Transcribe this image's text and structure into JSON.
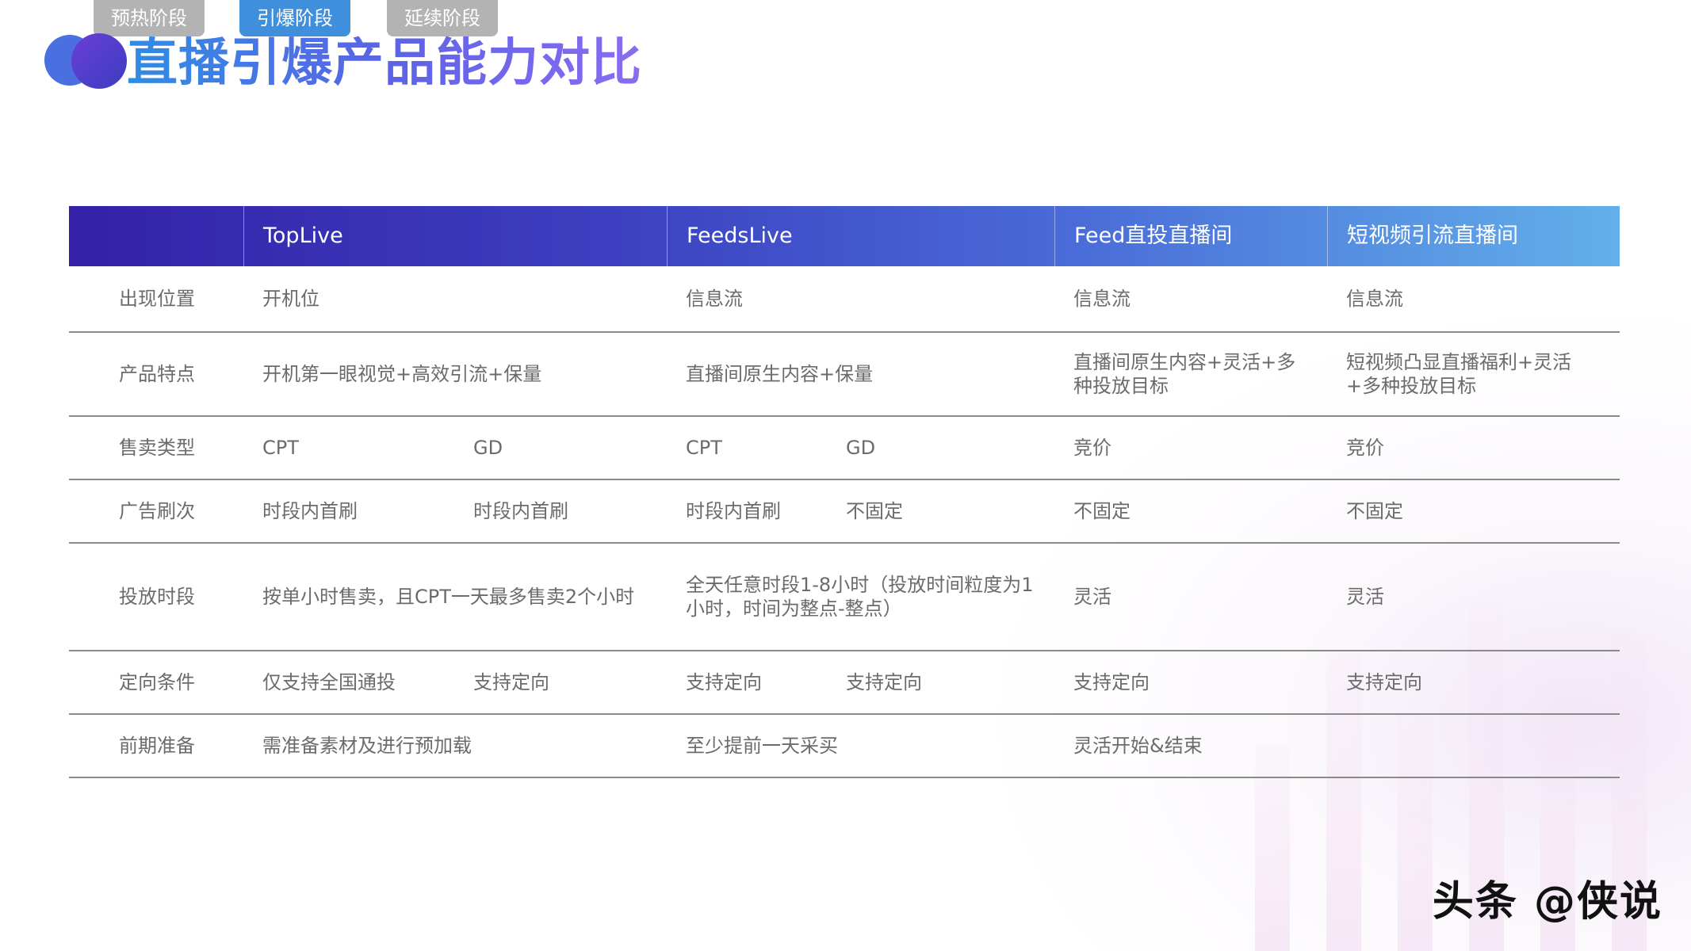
{
  "stages": [
    "预热阶段",
    "引爆阶段",
    "延续阶段"
  ],
  "title": "直播引爆产品能力对比",
  "table": {
    "headers": [
      "",
      "TopLive",
      "FeedsLive",
      "Feed直投直播间",
      "短视频引流直播间"
    ],
    "rows": [
      {
        "label": "出现位置",
        "toplive_a": "开机位",
        "toplive_b": "",
        "feeds_a": "信息流",
        "feeds_b": "",
        "feed_direct": "信息流",
        "short_video": "信息流"
      },
      {
        "label": "产品特点",
        "toplive_a": "开机第一眼视觉+高效引流+保量",
        "toplive_b": "",
        "feeds_a": "直播间原生内容+保量",
        "feeds_b": "",
        "feed_direct": "直播间原生内容+灵活+多种投放目标",
        "short_video": "短视频凸显直播福利+灵活+多种投放目标"
      },
      {
        "label": "售卖类型",
        "toplive_a": "CPT",
        "toplive_b": "GD",
        "feeds_a": "CPT",
        "feeds_b": "GD",
        "feed_direct": "竞价",
        "short_video": "竞价"
      },
      {
        "label": "广告刷次",
        "toplive_a": "时段内首刷",
        "toplive_b": "时段内首刷",
        "feeds_a": "时段内首刷",
        "feeds_b": "不固定",
        "feed_direct": "不固定",
        "short_video": "不固定"
      },
      {
        "label": "投放时段",
        "toplive_a": "按单小时售卖，且CPT一天最多售卖2个小时",
        "toplive_b": "",
        "feeds_a": "全天任意时段1-8小时（投放时间粒度为1小时，时间为整点-整点）",
        "feeds_b": "",
        "feed_direct": "灵活",
        "short_video": "灵活"
      },
      {
        "label": "定向条件",
        "toplive_a": "仅支持全国通投",
        "toplive_b": "支持定向",
        "feeds_a": "支持定向",
        "feeds_b": "支持定向",
        "feed_direct": "支持定向",
        "short_video": "支持定向"
      },
      {
        "label": "前期准备",
        "toplive_a": "需准备素材及进行预加载",
        "toplive_b": "",
        "feeds_a": "至少提前一天采买",
        "feeds_b": "",
        "feed_direct": "灵活开始&结束",
        "short_video": ""
      }
    ]
  },
  "watermark": "头条 @侠说"
}
